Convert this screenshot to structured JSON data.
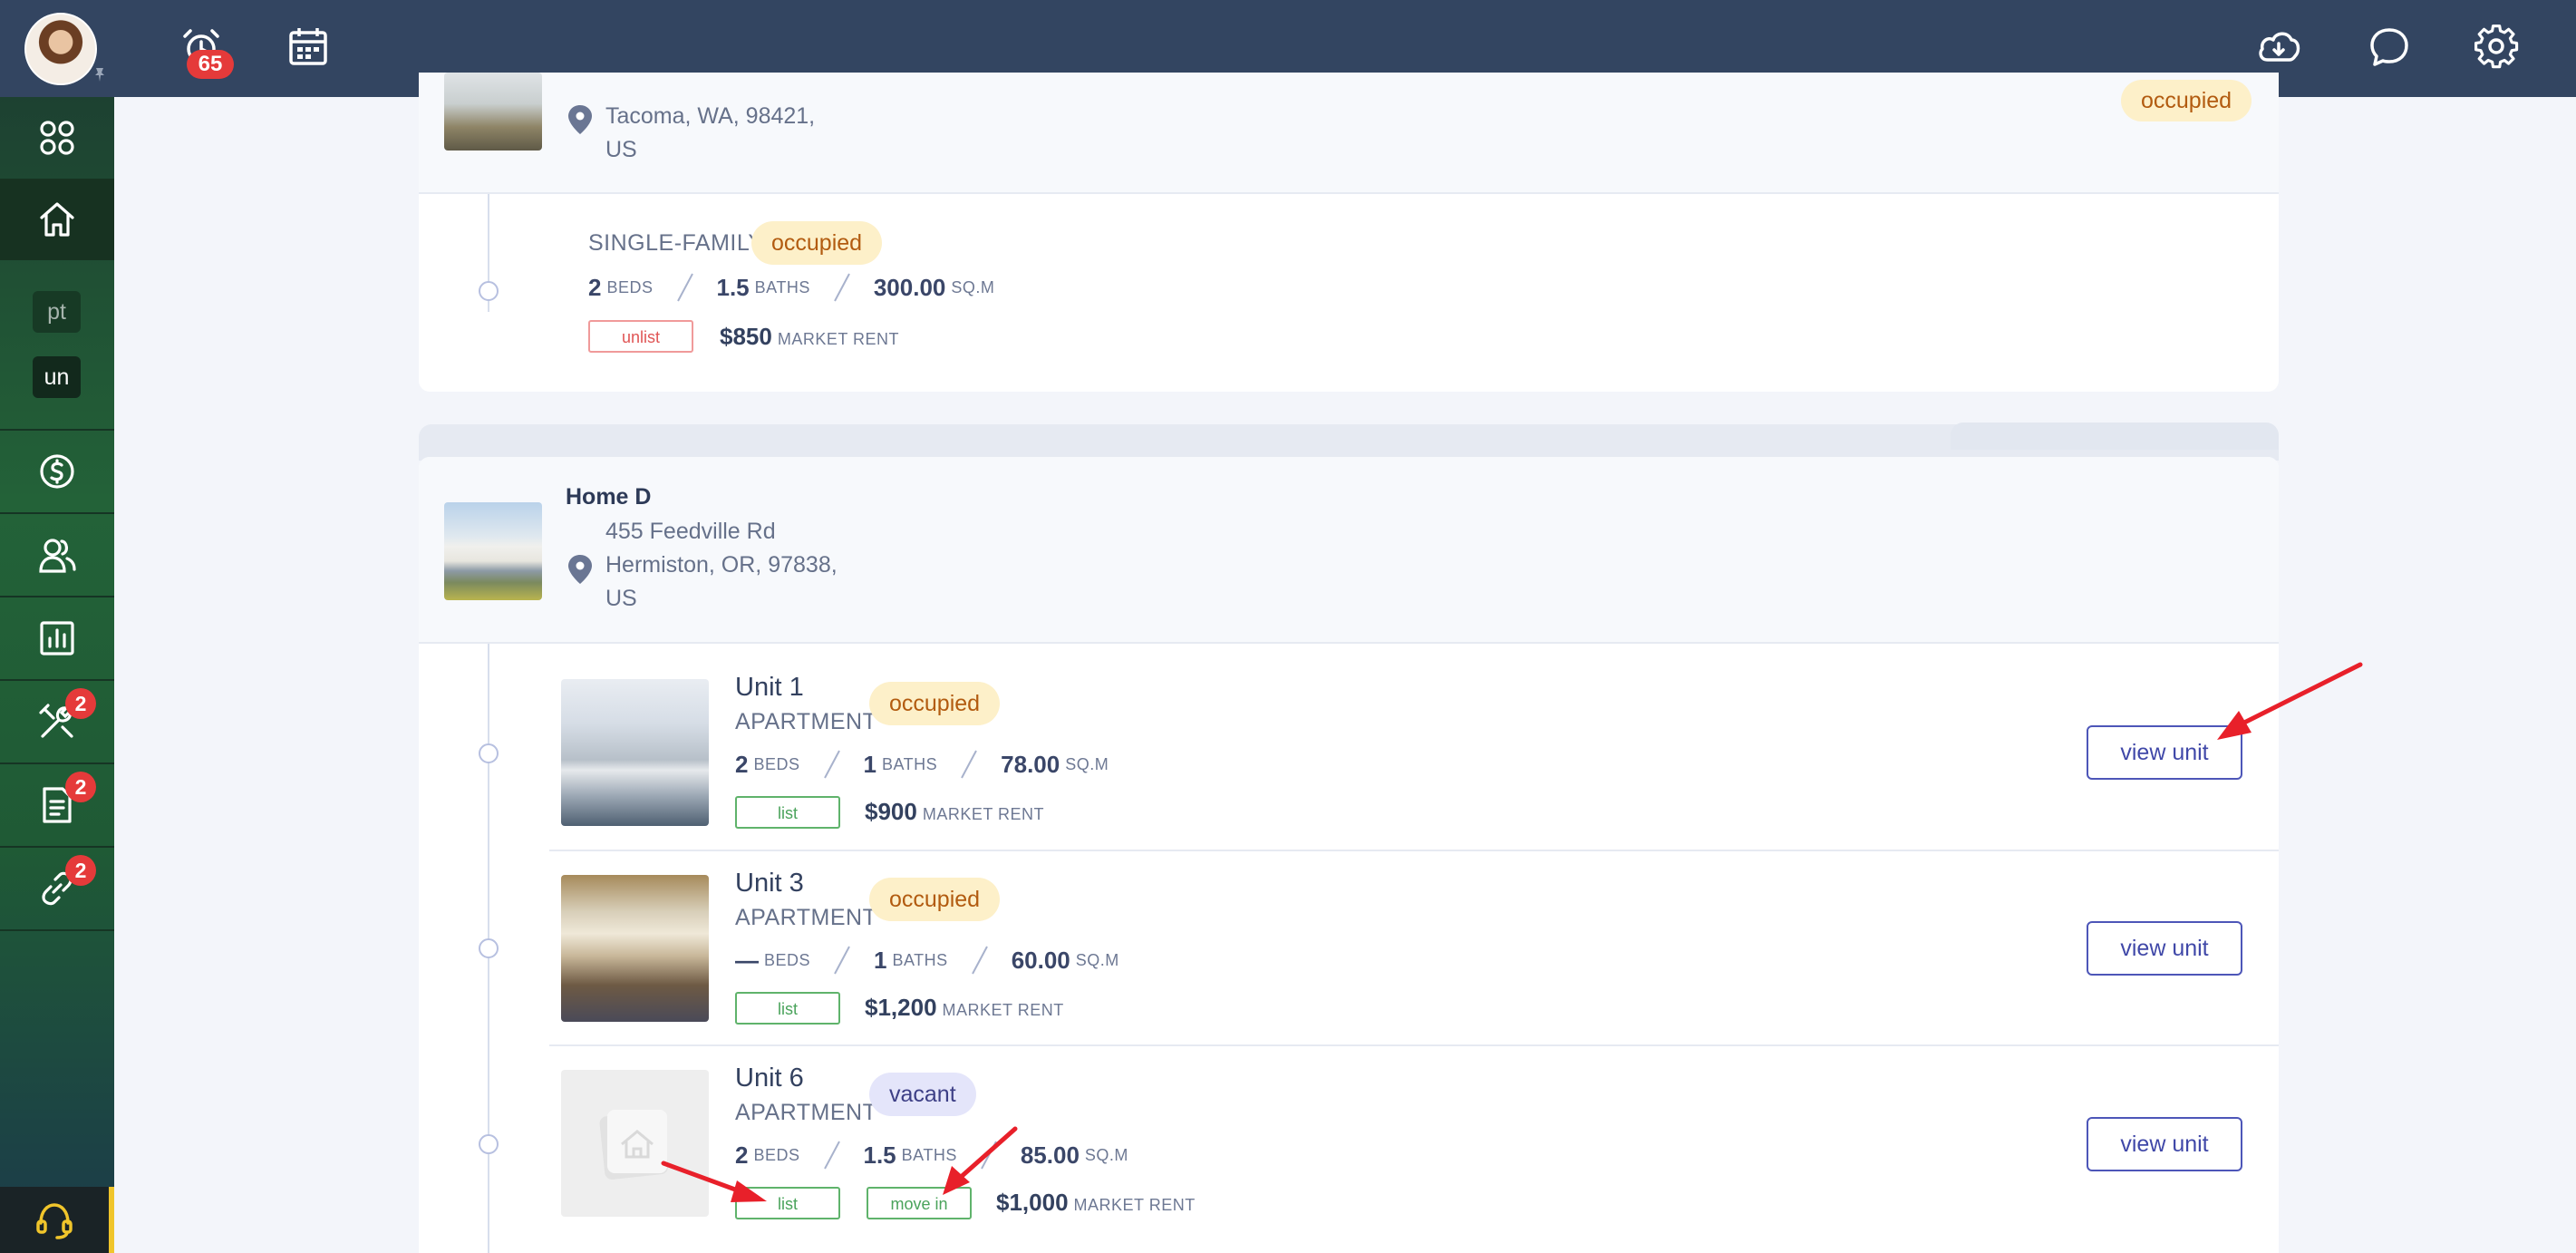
{
  "topbar": {
    "notification_count": "65",
    "icons": [
      "avatar",
      "notifications-icon",
      "calendar-icon",
      "cloud-download-icon",
      "chat-icon",
      "settings-icon"
    ]
  },
  "sidebar": {
    "chips": [
      "pt",
      "un"
    ],
    "badges": {
      "maintenance": "2",
      "applications": "2",
      "connections": "2"
    }
  },
  "property_top": {
    "address": [
      "Tacoma, WA, 98421,",
      "US"
    ],
    "status": "occupied",
    "unit": {
      "type": "SINGLE-FAMILY",
      "status": "occupied",
      "beds": "2",
      "beds_label": "BEDS",
      "baths": "1.5",
      "baths_label": "BATHS",
      "area": "300.00",
      "area_label": "SQ.M",
      "action": "unlist",
      "rent": "$850",
      "rent_label": "MARKET RENT"
    }
  },
  "property_d": {
    "name": "Home D",
    "address": [
      "455 Feedville Rd",
      "Hermiston, OR, 97838,",
      "US"
    ],
    "units": [
      {
        "name": "Unit 1",
        "type": "APARTMENT",
        "status": "occupied",
        "beds": "2",
        "baths": "1",
        "area": "78.00",
        "action": "list",
        "rent": "$900",
        "view": "view unit"
      },
      {
        "name": "Unit 3",
        "type": "APARTMENT",
        "status": "occupied",
        "beds": "—",
        "baths": "1",
        "area": "60.00",
        "action": "list",
        "rent": "$1,200",
        "view": "view unit"
      },
      {
        "name": "Unit 6",
        "type": "APARTMENT",
        "status": "vacant",
        "beds": "2",
        "baths": "1.5",
        "area": "85.00",
        "action": "list",
        "action2": "move in",
        "rent": "$1,000",
        "view": "view unit"
      }
    ],
    "labels": {
      "beds": "BEDS",
      "baths": "BATHS",
      "area": "SQ.M",
      "rent": "MARKET RENT"
    }
  },
  "colors": {
    "topbar": "#334561",
    "accent": "#4d56b8",
    "occupied": "#fdf0c9",
    "vacant": "#e4e5fa",
    "annotation": "#e8202a"
  }
}
